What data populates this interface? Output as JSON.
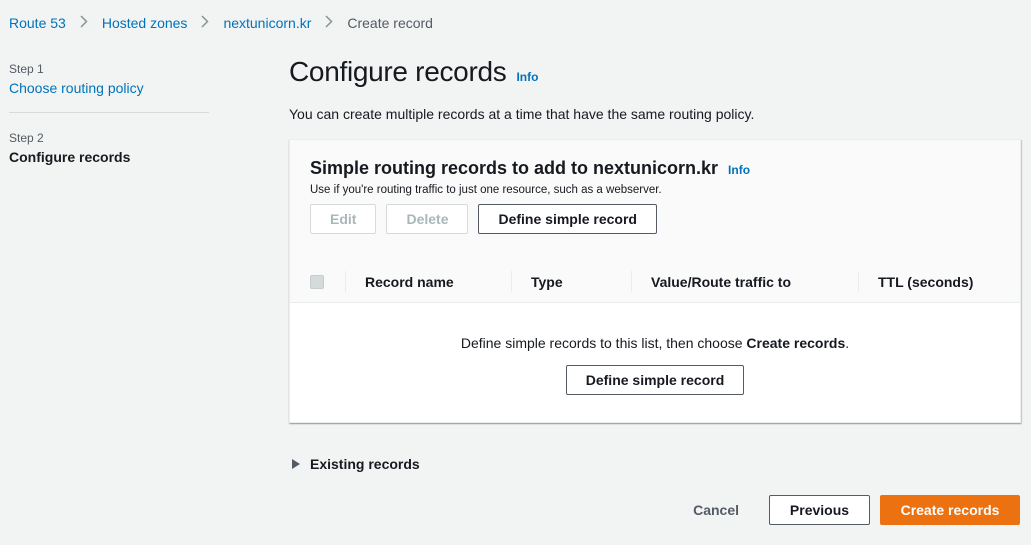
{
  "breadcrumb": {
    "items": [
      "Route 53",
      "Hosted zones",
      "nextunicorn.kr"
    ],
    "current": "Create record"
  },
  "steps": [
    {
      "num": "Step 1",
      "label": "Choose routing policy"
    },
    {
      "num": "Step 2",
      "label": "Configure records"
    }
  ],
  "main": {
    "title": "Configure records",
    "info": "Info",
    "description": "You can create multiple records at a time that have the same routing policy."
  },
  "container": {
    "title": "Simple routing records to add to nextunicorn.kr",
    "info": "Info",
    "subtitle": "Use if you're routing traffic to just one resource, such as a webserver.",
    "edit_label": "Edit",
    "delete_label": "Delete",
    "define_label": "Define simple record",
    "columns": [
      "Record name",
      "Type",
      "Value/Route traffic to",
      "TTL (seconds)"
    ],
    "empty_text_before": "Define simple records to this list, then choose ",
    "empty_text_bold": "Create records",
    "empty_text_after": ".",
    "empty_button": "Define simple record"
  },
  "existing": {
    "label": "Existing records"
  },
  "footer": {
    "cancel": "Cancel",
    "previous": "Previous",
    "create": "Create records"
  },
  "colors": {
    "accent": "#0073bb",
    "primary": "#ec7211",
    "background": "#f2f3f3"
  },
  "icons": {
    "separator": "chevron-right-icon",
    "expander": "caret-right-icon"
  }
}
